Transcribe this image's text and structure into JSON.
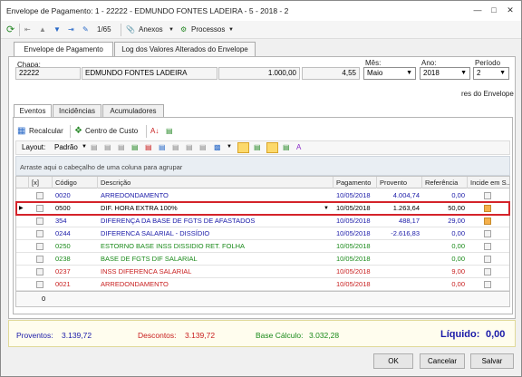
{
  "window": {
    "title": "Envelope de Pagamento: 1 - 22222 - EDMUNDO FONTES LADEIRA - 5 - 2018 - 2"
  },
  "toolbar": {
    "record_counter": "1/65",
    "anexos": "Anexos",
    "processos": "Processos"
  },
  "tabs_top": [
    "Envelope de Pagamento",
    "Log dos Valores Alterados do Envelope"
  ],
  "header": {
    "chapa_label": "Chapa:",
    "chapa": "22222",
    "nome": "EDMUNDO FONTES LADEIRA",
    "valor1": "1.000,00",
    "valor2": "4,55",
    "mes_label": "Mês:",
    "mes": "Maio",
    "ano_label": "Ano:",
    "ano": "2018",
    "periodo_label": "Período",
    "periodo": "2",
    "envelope_note": "res do Envelope"
  },
  "tabs_inner": [
    "Eventos",
    "Incidências",
    "Acumuladores"
  ],
  "actions": {
    "recalcular": "Recalcular",
    "centro_custo": "Centro de Custo"
  },
  "layout_bar": {
    "label": "Layout:",
    "value": "Padrão"
  },
  "group_hint": "Arraste aqui o cabeçalho de uma coluna para agrupar",
  "grid": {
    "columns": [
      "[x]",
      "Código",
      "Descrição",
      "Pagamento",
      "Provento",
      "Referência",
      "Incide em S..."
    ],
    "rows": [
      {
        "code": "0020",
        "desc": "ARREDONDAMENTO",
        "pagamento": "10/05/2018",
        "provento": "4.004,74",
        "referencia": "0,00",
        "incide": false,
        "color": "#1a1aa8"
      },
      {
        "code": "0500",
        "desc": "DIF. HORA EXTRA 100%",
        "pagamento": "10/05/2018",
        "provento": "1.263,64",
        "referencia": "50,00",
        "incide": true,
        "color": "#1a1aa8"
      },
      {
        "code": "354",
        "desc": "DIFERENÇA DA BASE DE FGTS DE AFASTADOS",
        "pagamento": "10/05/2018",
        "provento": "488,17",
        "referencia": "29,00",
        "incide": true,
        "color": "#1a1aa8"
      },
      {
        "code": "0244",
        "desc": "DIFERENCA SALARIAL - DISSÍDIO",
        "pagamento": "10/05/2018",
        "provento": "-2.616,83",
        "referencia": "0,00",
        "incide": false,
        "color": "#1a1aa8"
      },
      {
        "code": "0250",
        "desc": "ESTORNO BASE INSS DISSIDIO RET. FOLHA",
        "pagamento": "10/05/2018",
        "provento": "",
        "referencia": "0,00",
        "incide": false,
        "color": "#1a8a1a"
      },
      {
        "code": "0238",
        "desc": "BASE DE FGTS DIF SALARIAL",
        "pagamento": "10/05/2018",
        "provento": "",
        "referencia": "0,00",
        "incide": false,
        "color": "#1a8a1a"
      },
      {
        "code": "0237",
        "desc": "INSS DIFERENCA SALARIAL",
        "pagamento": "10/05/2018",
        "provento": "",
        "referencia": "9,00",
        "incide": false,
        "color": "#c81e1e"
      },
      {
        "code": "0021",
        "desc": "ARREDONDAMENTO",
        "pagamento": "10/05/2018",
        "provento": "",
        "referencia": "0,00",
        "incide": false,
        "color": "#c81e1e"
      }
    ],
    "footer_count": "0"
  },
  "summary": {
    "proventos_label": "Proventos:",
    "proventos": "3.139,72",
    "descontos_label": "Descontos:",
    "descontos": "3.139,72",
    "base_label": "Base Cálculo:",
    "base": "3.032,28",
    "liquido_label": "Líquido:",
    "liquido": "0,00",
    "colors": {
      "blue": "#1a1aa8",
      "red": "#c81e1e",
      "green": "#1a8a1a"
    }
  },
  "buttons": {
    "ok": "OK",
    "cancelar": "Cancelar",
    "salvar": "Salvar"
  },
  "colors": {
    "accent": "#1a1aa8",
    "highlight": "#d4232a"
  }
}
